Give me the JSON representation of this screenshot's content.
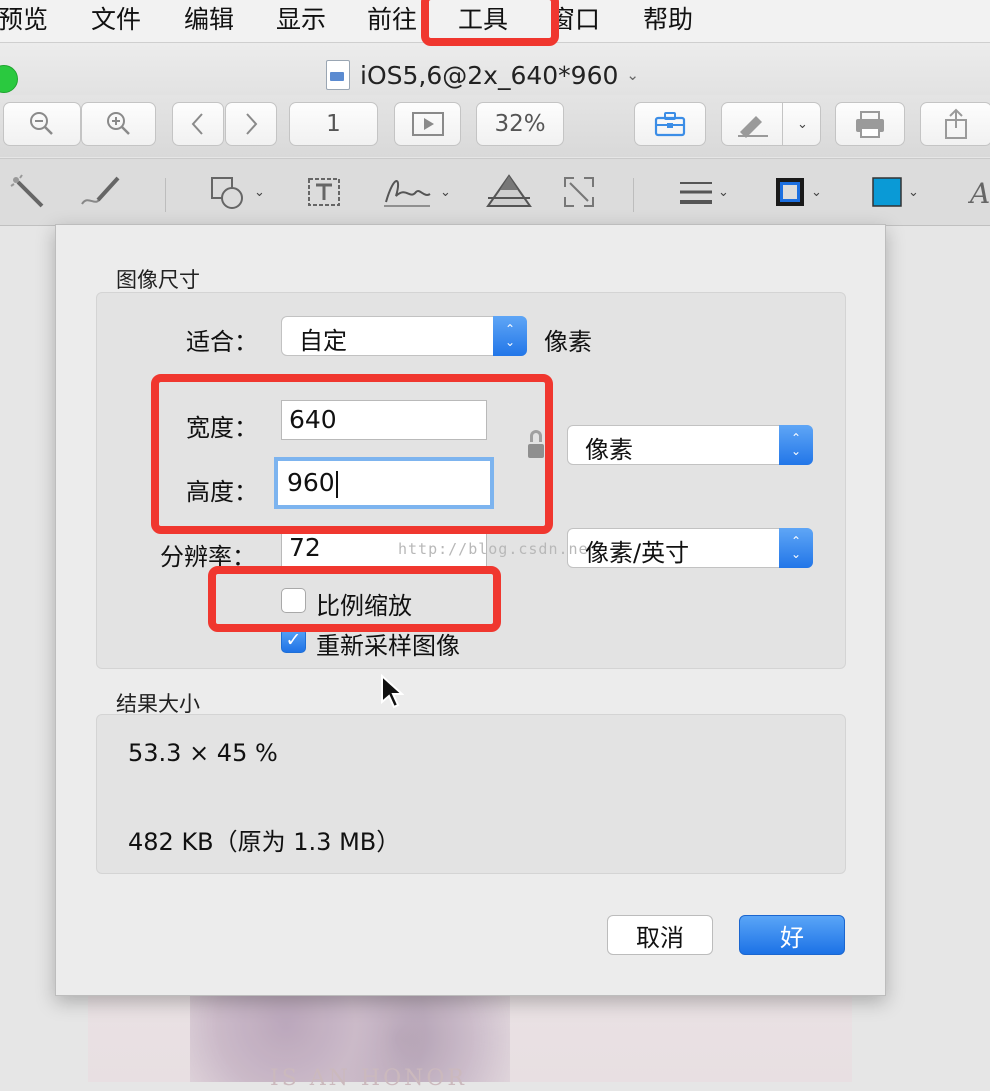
{
  "menubar": {
    "items": [
      "预览",
      "文件",
      "编辑",
      "显示",
      "前往",
      "工具",
      "窗口",
      "帮助"
    ]
  },
  "window": {
    "title": "iOS5,6@2x_640*960"
  },
  "toolbar": {
    "page_field": "1",
    "zoom_label": "32%"
  },
  "dialog": {
    "image_size_label": "图像尺寸",
    "fit_label": "适合：",
    "fit_value": "自定",
    "fit_unit": "像素",
    "width_label": "宽度：",
    "width_value": "640",
    "height_label": "高度：",
    "height_value": "960",
    "dimension_unit": "像素",
    "resolution_label": "分辨率：",
    "resolution_value": "72",
    "resolution_unit": "像素/英寸",
    "scale_proportionally_label": "比例缩放",
    "scale_proportionally_checked": false,
    "resample_label": "重新采样图像",
    "resample_checked": true,
    "result_size_label": "结果大小",
    "result_percent": "53.3 × 45 %",
    "result_filesize": "482 KB（原为 1.3 MB）",
    "cancel_label": "取消",
    "ok_label": "好"
  },
  "watermark": "http://blog.csdn.ne",
  "background_document": {
    "caption": "IS AN HONOR"
  },
  "colors": {
    "annotation_red": "#f0372f",
    "accent_blue": "#1f73e6",
    "focus_ring": "#7db4ef",
    "stroke_color_swatch": "#1c6fe0",
    "fill_color_swatch": "#0a9ad6",
    "traffic_light_green": "#2ac93f"
  },
  "icons": [
    "zoom-out-icon",
    "zoom-in-icon",
    "previous-page-icon",
    "next-page-icon",
    "slideshow-icon",
    "toolbox-icon",
    "markup-pen-icon",
    "print-icon",
    "share-icon",
    "magic-wand-icon",
    "sketch-icon",
    "shapes-icon",
    "text-box-icon",
    "signature-icon",
    "adjust-color-icon",
    "adjust-size-icon",
    "line-style-icon",
    "border-color-icon",
    "fill-color-icon",
    "lock-icon",
    "cursor-icon"
  ]
}
